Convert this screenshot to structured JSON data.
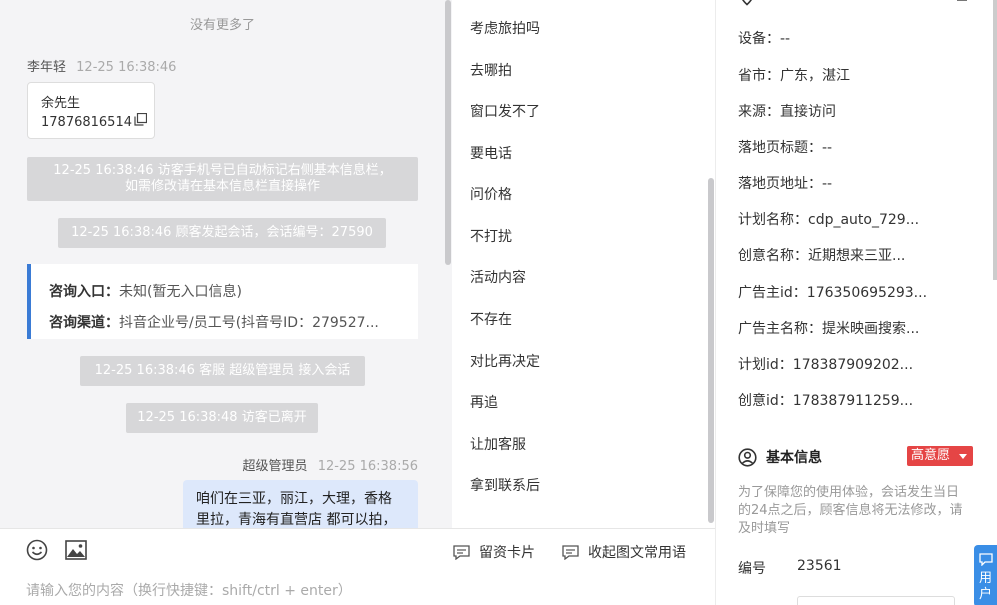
{
  "chat": {
    "no_more": "没有更多了",
    "visitor_name": "李年轻",
    "visitor_time": "12-25 16:38:46",
    "card_name": "余先生",
    "card_phone": "17876816514",
    "sys_msg_1_line1": "12-25 16:38:46 访客手机号已自动标记右侧基本信息栏，",
    "sys_msg_1_line2": "如需修改请在基本信息栏直接操作",
    "sys_msg_2": "12-25 16:38:46 顾客发起会话，会话编号：27590",
    "entry_label": "咨询入口：",
    "entry_value": "未知(暂无入口信息)",
    "channel_label": "咨询渠道：",
    "channel_value": "抖音企业号/员工号(抖音号ID：279527...",
    "sys_msg_3": "12-25 16:38:46 客服 超级管理员 接入会话",
    "sys_msg_4": "12-25 16:38:48 访客已离开",
    "agent_name": "超级管理员",
    "agent_time": "12-25 16:38:56",
    "bubble_line1": "咱们在三亚，丽江，大理，香格",
    "bubble_line2": "里拉，青海有直营店 都可以拍，"
  },
  "input": {
    "leave_card": "留资卡片",
    "collapse_phrases": "收起图文常用语",
    "placeholder": "请输入您的内容（换行快捷键：shift/ctrl + enter）"
  },
  "phrases": [
    "考虑旅拍吗",
    "去哪拍",
    "窗口发不了",
    "要电话",
    "问价格",
    "不打扰",
    "活动内容",
    "不存在",
    "对比再决定",
    "再追",
    "让加客服",
    "拿到联系后"
  ],
  "info": {
    "rows": [
      {
        "label": "设备：",
        "value": "--"
      },
      {
        "label": "省市：",
        "value": "广东，湛江"
      },
      {
        "label": "来源：",
        "value": "直接访问"
      },
      {
        "label": "落地页标题：",
        "value": "--"
      },
      {
        "label": "落地页地址：",
        "value": "--"
      },
      {
        "label": "计划名称：",
        "value": "cdp_auto_729..."
      },
      {
        "label": "创意名称：",
        "value": "近期想来三亚..."
      },
      {
        "label": "广告主id：",
        "value": "176350695293..."
      },
      {
        "label": "广告主名称：",
        "value": "提米映画搜索..."
      },
      {
        "label": "计划id：",
        "value": "178387909202..."
      },
      {
        "label": "创意id：",
        "value": "178387911259..."
      }
    ],
    "basic_title": "基本信息",
    "intent_badge": "高意愿",
    "notice": "为了保障您的使用体验，会话发生当日的24点之后，顾客信息将无法修改，请及时填写",
    "id_label": "编号",
    "id_value": "23561",
    "float_btn": "用户"
  },
  "icons": {
    "copy": "copy-icon",
    "emoji": "emoji-icon",
    "image": "image-icon",
    "card": "card-icon",
    "chat": "chat-icon",
    "user": "user-circle-icon",
    "location": "location-icon"
  }
}
